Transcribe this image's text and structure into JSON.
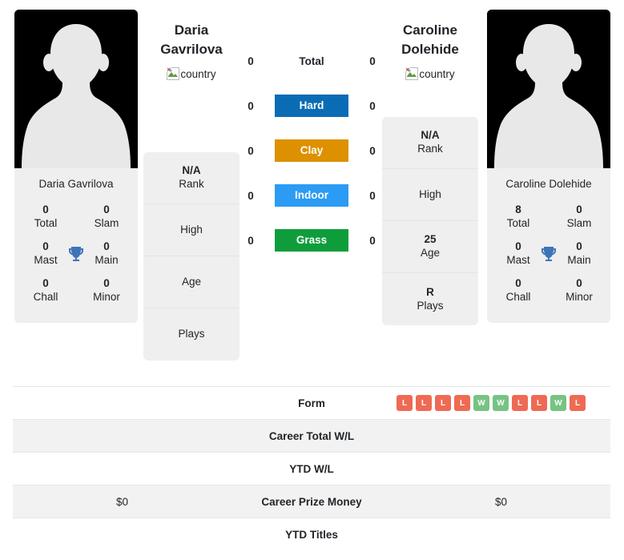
{
  "players": {
    "left": {
      "name": "Daria\nGavrilova",
      "photo_caption": "Daria Gavrilova",
      "country_alt": "country",
      "avatar_icon": "person-silhouette-icon",
      "titles": [
        {
          "num": "0",
          "label": "Total"
        },
        {
          "num": "0",
          "label": "Slam"
        },
        {
          "num": "0",
          "label": "Mast"
        },
        {
          "num": "0",
          "label": "Main"
        },
        {
          "num": "0",
          "label": "Chall"
        },
        {
          "num": "0",
          "label": "Minor"
        }
      ],
      "info": [
        {
          "value": "N/A",
          "label": "Rank"
        },
        {
          "value": "",
          "label": "High"
        },
        {
          "value": "",
          "label": "Age"
        },
        {
          "value": "",
          "label": "Plays"
        }
      ]
    },
    "right": {
      "name": "Caroline\nDolehide",
      "photo_caption": "Caroline Dolehide",
      "country_alt": "country",
      "avatar_icon": "person-silhouette-icon",
      "titles": [
        {
          "num": "8",
          "label": "Total"
        },
        {
          "num": "0",
          "label": "Slam"
        },
        {
          "num": "0",
          "label": "Mast"
        },
        {
          "num": "0",
          "label": "Main"
        },
        {
          "num": "0",
          "label": "Chall"
        },
        {
          "num": "0",
          "label": "Minor"
        }
      ],
      "info": [
        {
          "value": "N/A",
          "label": "Rank"
        },
        {
          "value": "",
          "label": "High"
        },
        {
          "value": "25",
          "label": "Age"
        },
        {
          "value": "R",
          "label": "Plays"
        }
      ]
    }
  },
  "trophy_icon": "trophy-icon",
  "surfaces": [
    {
      "label": "Total",
      "left": "0",
      "right": "0",
      "style": "plain",
      "color": ""
    },
    {
      "label": "Hard",
      "left": "0",
      "right": "0",
      "style": "badge",
      "color": "#0a6cb4"
    },
    {
      "label": "Clay",
      "left": "0",
      "right": "0",
      "style": "badge",
      "color": "#dd9000"
    },
    {
      "label": "Indoor",
      "left": "0",
      "right": "0",
      "style": "badge",
      "color": "#2b9bf4"
    },
    {
      "label": "Grass",
      "left": "0",
      "right": "0",
      "style": "badge",
      "color": "#0f9d3c"
    }
  ],
  "table": {
    "rows": [
      {
        "label": "Form",
        "left": "",
        "right": "",
        "shade": false,
        "type": "form"
      },
      {
        "label": "Career Total W/L",
        "left": "",
        "right": "",
        "shade": true,
        "type": "text"
      },
      {
        "label": "YTD W/L",
        "left": "",
        "right": "",
        "shade": false,
        "type": "text"
      },
      {
        "label": "Career Prize Money",
        "left": "$0",
        "right": "$0",
        "shade": true,
        "type": "text"
      },
      {
        "label": "YTD Titles",
        "left": "",
        "right": "",
        "shade": false,
        "type": "text"
      }
    ],
    "form_right": [
      "L",
      "L",
      "L",
      "L",
      "W",
      "W",
      "L",
      "L",
      "W",
      "L"
    ],
    "form_colors": {
      "W": "#77c383",
      "L": "#ef6a54"
    }
  }
}
